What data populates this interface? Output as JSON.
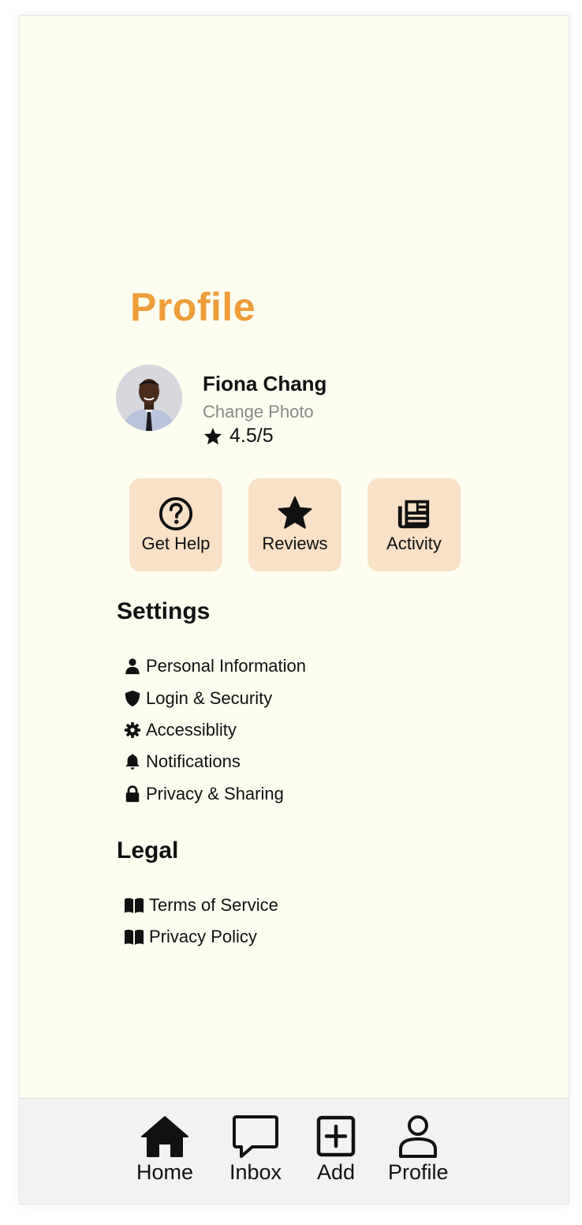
{
  "header": {
    "title": "Profile"
  },
  "user": {
    "name": "Fiona Chang",
    "change_photo_label": "Change Photo",
    "rating": "4.5/5"
  },
  "quick_actions": [
    {
      "label": "Get Help",
      "icon": "question-circle-icon"
    },
    {
      "label": "Reviews",
      "icon": "star-icon"
    },
    {
      "label": "Activity",
      "icon": "newspaper-icon"
    }
  ],
  "settings": {
    "title": "Settings",
    "items": [
      {
        "label": "Personal Information",
        "icon": "person-icon"
      },
      {
        "label": "Login & Security",
        "icon": "shield-icon"
      },
      {
        "label": "Accessiblity",
        "icon": "gear-icon"
      },
      {
        "label": "Notifications",
        "icon": "bell-icon"
      },
      {
        "label": "Privacy & Sharing",
        "icon": "lock-icon"
      }
    ]
  },
  "legal": {
    "title": "Legal",
    "items": [
      {
        "label": "Terms of Service",
        "icon": "book-icon"
      },
      {
        "label": "Privacy Policy",
        "icon": "book-icon"
      }
    ]
  },
  "tabbar": {
    "items": [
      {
        "label": "Home",
        "icon": "home-icon"
      },
      {
        "label": "Inbox",
        "icon": "chat-bubble-icon"
      },
      {
        "label": "Add",
        "icon": "plus-square-icon"
      },
      {
        "label": "Profile",
        "icon": "person-outline-icon"
      }
    ]
  },
  "colors": {
    "accent": "#ee9d3a",
    "background": "#fdfdf0",
    "button_bg": "#f8e1c6",
    "tabbar_bg": "#f2f2f2"
  }
}
